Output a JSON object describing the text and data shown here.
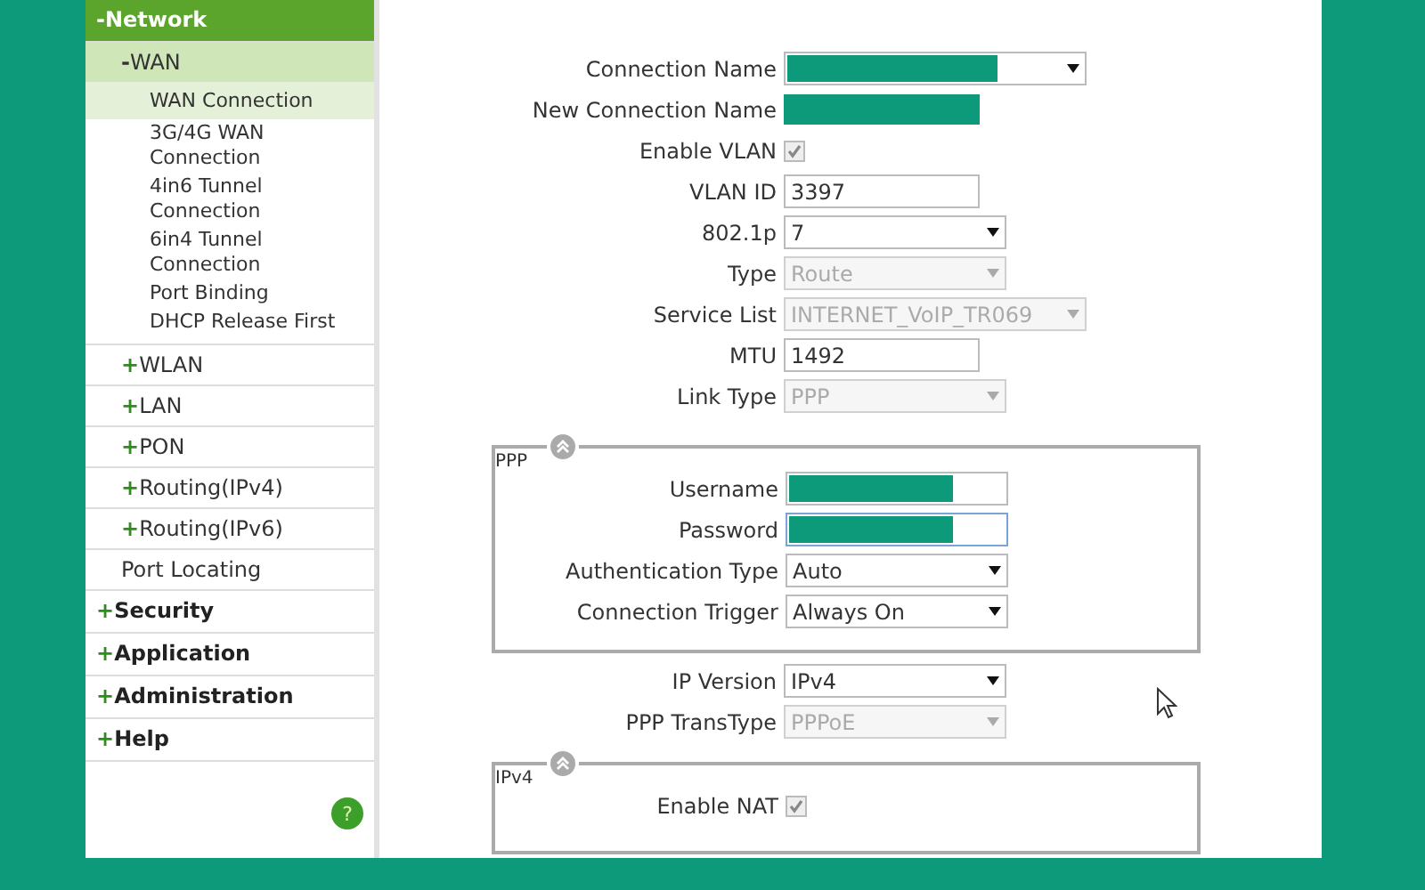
{
  "sidebar": {
    "items": [
      {
        "sign": "-",
        "label": "Network",
        "selected": false,
        "children": [
          {
            "sign": "-",
            "label": "WAN",
            "selected": false,
            "children": [
              {
                "label": "WAN Connection",
                "selected": true
              },
              {
                "label": "3G/4G WAN Connection",
                "selected": false
              },
              {
                "label": "4in6 Tunnel Connection",
                "selected": false
              },
              {
                "label": "6in4 Tunnel Connection",
                "selected": false
              },
              {
                "label": "Port Binding",
                "selected": false
              },
              {
                "label": "DHCP Release First",
                "selected": false
              }
            ]
          },
          {
            "sign": "+",
            "label": "WLAN",
            "selected": false
          },
          {
            "sign": "+",
            "label": "LAN",
            "selected": false
          },
          {
            "sign": "+",
            "label": "PON",
            "selected": false
          },
          {
            "sign": "+",
            "label": "Routing(IPv4)",
            "selected": false
          },
          {
            "sign": "+",
            "label": "Routing(IPv6)",
            "selected": false
          },
          {
            "label": "Port Locating",
            "selected": false
          }
        ]
      },
      {
        "sign": "+",
        "label": "Security",
        "selected": false
      },
      {
        "sign": "+",
        "label": "Application",
        "selected": false
      },
      {
        "sign": "+",
        "label": "Administration",
        "selected": false
      },
      {
        "sign": "+",
        "label": "Help",
        "selected": false
      }
    ],
    "help_button": "?"
  },
  "sections": [
    {
      "kind": "rows",
      "rows": [
        {
          "label": "Connection Name",
          "kind": "select",
          "redacted": true,
          "disabled": false
        },
        {
          "label": "New Connection Name",
          "kind": "text",
          "redacted": true
        },
        {
          "label": "Enable VLAN",
          "kind": "checkbox",
          "checked": true,
          "disabled": true
        },
        {
          "label": "VLAN ID",
          "kind": "text",
          "value": "3397",
          "disabled": false
        },
        {
          "label": "802.1p",
          "kind": "select",
          "value": "7",
          "disabled": false
        },
        {
          "label": "Type",
          "kind": "select",
          "value": "Route",
          "disabled": true
        },
        {
          "label": "Service List",
          "kind": "select",
          "value": "INTERNET_VoIP_TR069",
          "disabled": true
        },
        {
          "label": "MTU",
          "kind": "text",
          "value": "1492",
          "disabled": false
        },
        {
          "label": "Link Type",
          "kind": "select",
          "value": "PPP",
          "disabled": true
        }
      ]
    },
    {
      "kind": "group",
      "legend": "PPP",
      "rows": [
        {
          "label": "Username",
          "kind": "text",
          "redacted": true,
          "disabled": false
        },
        {
          "label": "Password",
          "kind": "text",
          "redacted": true,
          "disabled": false,
          "focused": true
        },
        {
          "label": "Authentication Type",
          "kind": "select",
          "value": "Auto",
          "disabled": false
        },
        {
          "label": "Connection Trigger",
          "kind": "select",
          "value": "Always On",
          "disabled": false
        }
      ]
    },
    {
      "kind": "rows",
      "rows": [
        {
          "label": "IP Version",
          "kind": "select",
          "value": "IPv4",
          "disabled": false
        },
        {
          "label": "PPP TransType",
          "kind": "select",
          "value": "PPPoE",
          "disabled": true
        }
      ]
    },
    {
      "kind": "group",
      "legend": "IPv4",
      "rows": [
        {
          "label": "Enable NAT",
          "kind": "checkbox",
          "checked": true,
          "disabled": true
        }
      ]
    }
  ]
}
